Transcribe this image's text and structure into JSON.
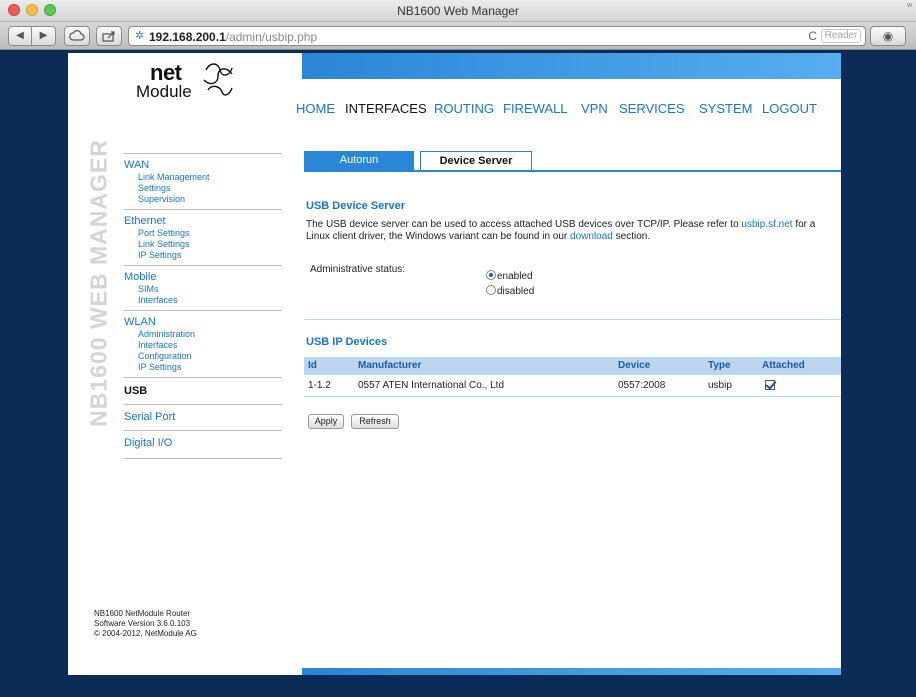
{
  "window": {
    "title": "NB1600 Web Manager",
    "corner": "w"
  },
  "toolbar": {
    "back": "◀",
    "forward": "▶",
    "url_host": "192.168.200.1",
    "url_path": "/admin/usbip.php",
    "reload": "C",
    "reader": "Reader"
  },
  "logo": {
    "net": "net",
    "module": "Module"
  },
  "watermark": "NB1600 WEB MANAGER",
  "nav": [
    "HOME",
    "INTERFACES",
    "ROUTING",
    "FIREWALL",
    "VPN",
    "SERVICES",
    "SYSTEM",
    "LOGOUT"
  ],
  "sidebar": {
    "wan": {
      "label": "WAN",
      "items": [
        "Link Management",
        "Settings",
        "Supervision"
      ]
    },
    "ethernet": {
      "label": "Ethernet",
      "items": [
        "Port Settings",
        "Link Settings",
        "IP Settings"
      ]
    },
    "mobile": {
      "label": "Mobile",
      "items": [
        "SIMs",
        "Interfaces"
      ]
    },
    "wlan": {
      "label": "WLAN",
      "items": [
        "Administration",
        "Interfaces",
        "Configuration",
        "IP Settings"
      ]
    },
    "usb": "USB",
    "serial": "Serial Port",
    "digital": "Digital I/O"
  },
  "footer": {
    "line1": "NB1600 NetModule Router",
    "line2": "Software Version 3.6.0.103",
    "line3": "© 2004-2012, NetModule AG"
  },
  "tabs": {
    "autorun": "Autorun",
    "device_server": "Device Server"
  },
  "device_server": {
    "title": "USB Device Server",
    "desc_1": "The USB device server can be used to access attached USB devices over TCP/IP. Please refer to ",
    "desc_link1": "usbip.sf.net",
    "desc_2": " for a Linux client driver, the Windows variant can be found in our ",
    "desc_link2": "download",
    "desc_3": " section.",
    "admin_label": "Administrative status:",
    "opt_enabled": "enabled",
    "opt_disabled": "disabled",
    "selected": "enabled"
  },
  "usb_ip": {
    "title": "USB IP Devices",
    "headers": {
      "id": "Id",
      "manufacturer": "Manufacturer",
      "device": "Device",
      "type": "Type",
      "attached": "Attached"
    },
    "rows": [
      {
        "id": "1-1.2",
        "manufacturer": "0557 ATEN International Co., Ltd",
        "device": "0557:2008",
        "type": "usbip",
        "attached": true
      }
    ]
  },
  "buttons": {
    "apply": "Apply",
    "refresh": "Refresh"
  },
  "colors": {
    "accent": "#2a86d6",
    "link": "#1a75c8",
    "background": "#0b2c57",
    "table_header": "#bcd6ef"
  }
}
